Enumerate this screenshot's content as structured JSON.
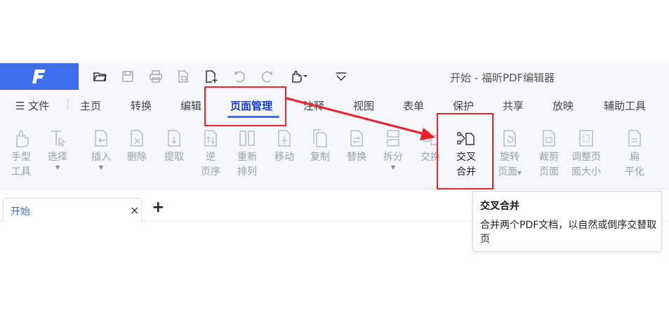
{
  "app": {
    "title": "开始 - 福昕PDF编辑器",
    "brand_color": "#3d6ef0",
    "quick_access_icons": [
      "open-folder-icon",
      "save-icon",
      "print-icon",
      "create-from-icon",
      "new-file-icon",
      "undo-icon",
      "redo-icon",
      "hand-tool-icon",
      "customize-icon"
    ]
  },
  "menu": {
    "file": "文件",
    "items": [
      "主页",
      "转换",
      "编辑",
      "页面管理",
      "注释",
      "视图",
      "表单",
      "保护",
      "共享",
      "放映",
      "辅助工具"
    ],
    "active": "页面管理"
  },
  "ribbon": {
    "tools": [
      {
        "l1": "手型",
        "l2": "工具"
      },
      {
        "l1": "选择",
        "l2": ""
      },
      {
        "l1": "插入",
        "l2": ""
      },
      {
        "l1": "删除",
        "l2": ""
      },
      {
        "l1": "提取",
        "l2": ""
      },
      {
        "l1": "逆",
        "l2": "页序"
      },
      {
        "l1": "重新",
        "l2": "排列"
      },
      {
        "l1": "移动",
        "l2": ""
      },
      {
        "l1": "复制",
        "l2": ""
      },
      {
        "l1": "替换",
        "l2": ""
      },
      {
        "l1": "拆分",
        "l2": ""
      },
      {
        "l1": "交换",
        "l2": ""
      },
      {
        "l1": "交叉",
        "l2": "合并"
      },
      {
        "l1": "旋转",
        "l2": "页面"
      },
      {
        "l1": "裁剪",
        "l2": "页面"
      },
      {
        "l1": "调整页",
        "l2": "面大小"
      },
      {
        "l1": "扁",
        "l2": "平化"
      }
    ]
  },
  "doc_tab": {
    "label": "开始",
    "close": "×",
    "add": "+"
  },
  "tooltip": {
    "title": "交叉合并",
    "body": "合并两个PDF文档，以自然或倒序交替取页"
  },
  "annotation_color": "#e8232b"
}
